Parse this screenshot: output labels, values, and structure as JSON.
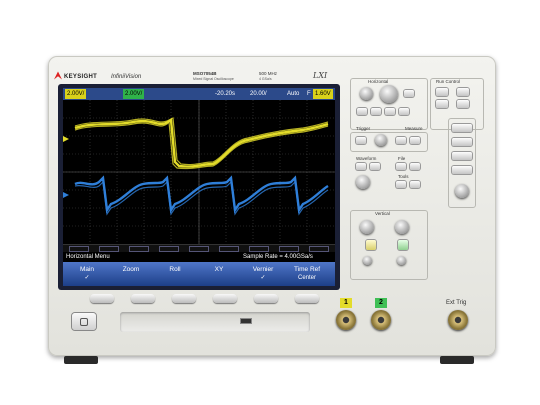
{
  "header": {
    "brand": "KEYSIGHT",
    "series": "InfiniiVision",
    "model": "MSO7054B",
    "subtitle": "Mixed Signal Oscilloscope",
    "bandwidth": "500 MHz",
    "sample_rate": "4 GSa/s",
    "lxi": "LXI"
  },
  "screen": {
    "top_bar": {
      "ch1_scale": "2.00V/",
      "ch2_scale": "2.00V/",
      "delay": "-20.20s",
      "timebase": "20.00/",
      "acq_mode": "Auto",
      "trig_flag": "F",
      "trig_level": "1.60V"
    },
    "menu_title": "Horizontal Menu",
    "menu_sample_rate": "Sample Rate = 4.00GSa/s",
    "softkeys": [
      {
        "label": "Main",
        "sub": "✓"
      },
      {
        "label": "Zoom",
        "sub": ""
      },
      {
        "label": "Roll",
        "sub": ""
      },
      {
        "label": "XY",
        "sub": ""
      },
      {
        "label": "Vernier",
        "sub": "✓"
      },
      {
        "label": "Time Ref",
        "sub": "Center"
      }
    ]
  },
  "panel": {
    "horizontal": "Horizontal",
    "run_control": "Run Control",
    "trigger": "Trigger",
    "measure": "Measure",
    "waveform": "Waveform",
    "file": "File",
    "tools": "Tools",
    "vertical": "Vertical",
    "ext_trig": "Ext Trig",
    "channel_numbers": [
      "1",
      "2"
    ]
  },
  "colors": {
    "ch1": "#e3dc2a",
    "ch2": "#2f7fd9",
    "menu_blue": "#2d5bb5"
  }
}
